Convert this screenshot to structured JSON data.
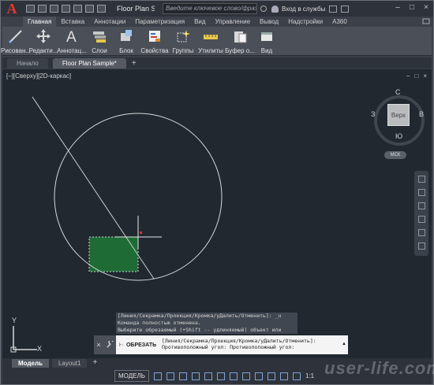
{
  "app": {
    "logo": "A",
    "document_title": "Floor Plan S...",
    "search_placeholder": "Введите ключевое слово/фразу",
    "signin_label": "Вход в службы",
    "window_controls": [
      "–",
      "□",
      "×"
    ]
  },
  "ribbon": {
    "tabs": [
      "Главная",
      "Вставка",
      "Аннотации",
      "Параметризация",
      "Вид",
      "Управление",
      "Вывод",
      "Надстройки",
      "A360"
    ],
    "active_tab": "Главная",
    "buttons": [
      {
        "label": "Рисован...",
        "icon": "draw-line-icon"
      },
      {
        "label": "Редакти...",
        "icon": "move-arrows-icon"
      },
      {
        "label": "Аннотац...",
        "icon": "annotation-text-icon"
      },
      {
        "label": "Слои",
        "icon": "layers-icon"
      },
      {
        "label": "Блок",
        "icon": "block-icon"
      },
      {
        "label": "Свойства",
        "icon": "properties-icon"
      },
      {
        "label": "Группы",
        "icon": "groups-icon"
      },
      {
        "label": "Утилиты",
        "icon": "measure-icon"
      },
      {
        "label": "Буфер о...",
        "icon": "clipboard-icon"
      },
      {
        "label": "Вид",
        "icon": "view-icon"
      }
    ]
  },
  "file_tabs": {
    "items": [
      "Начало",
      "Floor Plan Sample*"
    ],
    "active": "Floor Plan Sample*",
    "add_label": "+"
  },
  "canvas": {
    "view_label": "[–][Сверху][2D-каркас]",
    "viewport_controls": [
      "–",
      "□",
      "×"
    ],
    "background": "#212830",
    "hatch_color": "#1e6b36"
  },
  "viewcube": {
    "top_label": "Верх",
    "north": "С",
    "south": "Ю",
    "east": "В",
    "west": "З",
    "wcs_label": "МСК"
  },
  "command_history": [
    "[Линия/Секрамка/Проекция/Кромка/уДалить/Отменить]: _u",
    "Команда полностью отменена.",
    "Выберите обрезаемый (+Shift -- удлиняемый) объект или"
  ],
  "command_line": {
    "tool_buttons": [
      "×",
      "🔧"
    ],
    "command_name": "ОБРЕЗАТЬ",
    "prompt_lines": [
      "[Линия/Секрамка/Проекция/Кромка/уДалить/Отменить]:",
      "Противоположный угол: Противоположный угол:"
    ]
  },
  "ucs": {
    "x_label": "X",
    "y_label": "Y"
  },
  "layout_tabs": {
    "items": [
      "Модель",
      "Layout1"
    ],
    "active": "Модель",
    "add_label": "+"
  },
  "status_bar": {
    "model_label": "МОДЕЛЬ",
    "scale_label": "1:1"
  },
  "watermark": "user-life.com"
}
